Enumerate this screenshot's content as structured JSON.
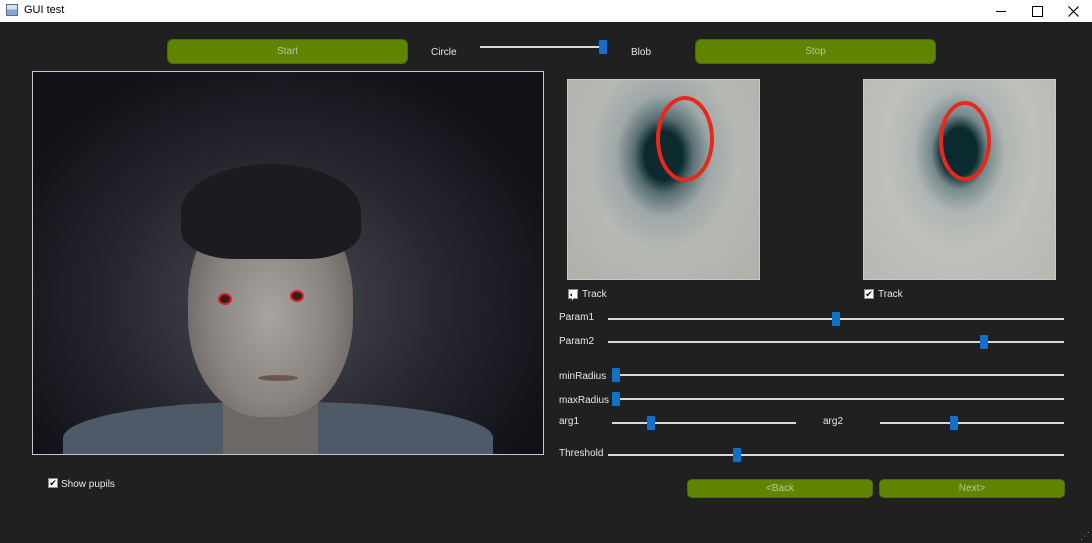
{
  "window": {
    "title": "GUI test"
  },
  "controls": {
    "start_label": "Start",
    "stop_label": "Stop",
    "circle_label": "Circle",
    "blob_label": "Blob",
    "mode_slider_value": 1.0
  },
  "left_eye": {
    "track_label": "Track",
    "track_checked": true
  },
  "right_eye": {
    "track_label": "Track",
    "track_checked": true
  },
  "sliders": {
    "param1": {
      "label": "Param1",
      "value": 0.5
    },
    "param2": {
      "label": "Param2",
      "value": 0.83
    },
    "minradius": {
      "label": "minRadius",
      "value": 0.0
    },
    "maxradius": {
      "label": "maxRadius",
      "value": 0.0
    },
    "arg1": {
      "label": "arg1",
      "value": 0.2
    },
    "arg2": {
      "label": "arg2",
      "value": 0.4
    },
    "threshold": {
      "label": "Threshold",
      "value": 0.28
    }
  },
  "show_pupils": {
    "label": "Show pupils",
    "checked": true
  },
  "nav": {
    "back_label": "<Back",
    "next_label": "Next>"
  },
  "colors": {
    "button_green": "#5e8400",
    "slider_handle": "#1270c8",
    "pupil_ring": "#e8281c",
    "background": "#202020"
  },
  "icons": {
    "window_icon": "app-window-icon",
    "minimize": "minimize-icon",
    "maximize": "maximize-icon",
    "close": "close-icon"
  }
}
